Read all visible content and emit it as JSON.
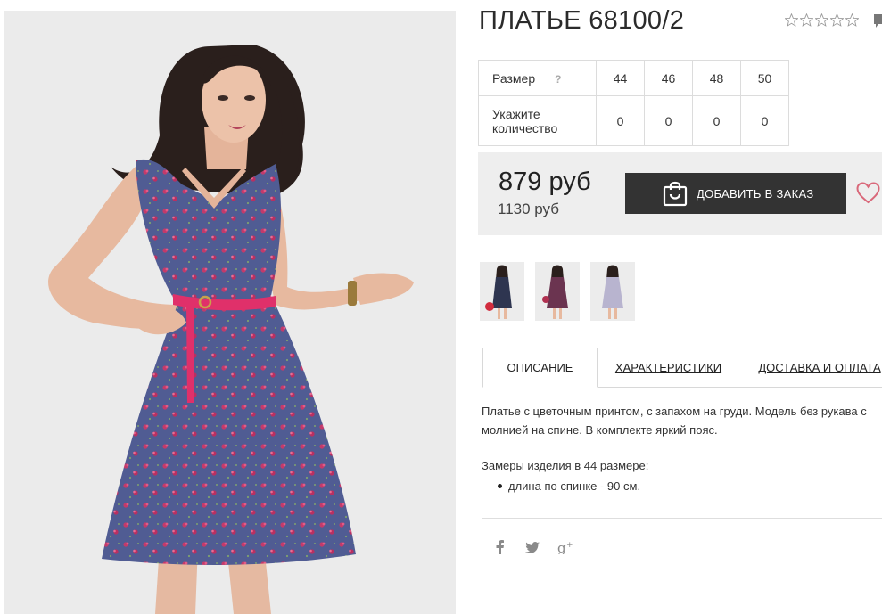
{
  "product": {
    "title": "ПЛАТЬЕ 68100/2",
    "rating": {
      "stars": 0,
      "max": 5
    }
  },
  "sizes": {
    "size_label": "Размер",
    "help_mark": "?",
    "qty_label": "Укажите количество",
    "columns": [
      {
        "size": "44",
        "qty": "0"
      },
      {
        "size": "46",
        "qty": "0"
      },
      {
        "size": "48",
        "qty": "0"
      },
      {
        "size": "50",
        "qty": "0"
      }
    ]
  },
  "price": {
    "current": "879 руб",
    "old": "1130 руб",
    "add_button": "ДОБАВИТЬ В ЗАКАЗ"
  },
  "thumbnails": [
    {
      "name": "thumb-dress-navy",
      "dress_color": "#2e3550"
    },
    {
      "name": "thumb-dress-print-red",
      "dress_color": "#6b3450"
    },
    {
      "name": "thumb-dress-lilac",
      "dress_color": "#b8b4cf"
    }
  ],
  "tabs": [
    {
      "label": "ОПИСАНИЕ",
      "active": true
    },
    {
      "label": "ХАРАКТЕРИСТИКИ",
      "active": false
    },
    {
      "label": "ДОСТАВКА И ОПЛАТА",
      "active": false
    }
  ],
  "description": {
    "text": "Платье с цветочным принтом, с запахом на груди. Модель без рукава с молнией на спине. В комплекте яркий пояс.",
    "measures_title": "Замеры изделия в 44 размере:",
    "measures": [
      "длина по спинке - 90 см."
    ]
  },
  "social": [
    "facebook-icon",
    "twitter-icon",
    "google-plus-icon"
  ],
  "colors": {
    "button_bg": "#333333",
    "price_bar_bg": "#eeeeee",
    "wishlist": "#d9687a",
    "old_price_strike": "#c0392b",
    "dress": "#4f5a8f",
    "belt": "#e0306a"
  }
}
